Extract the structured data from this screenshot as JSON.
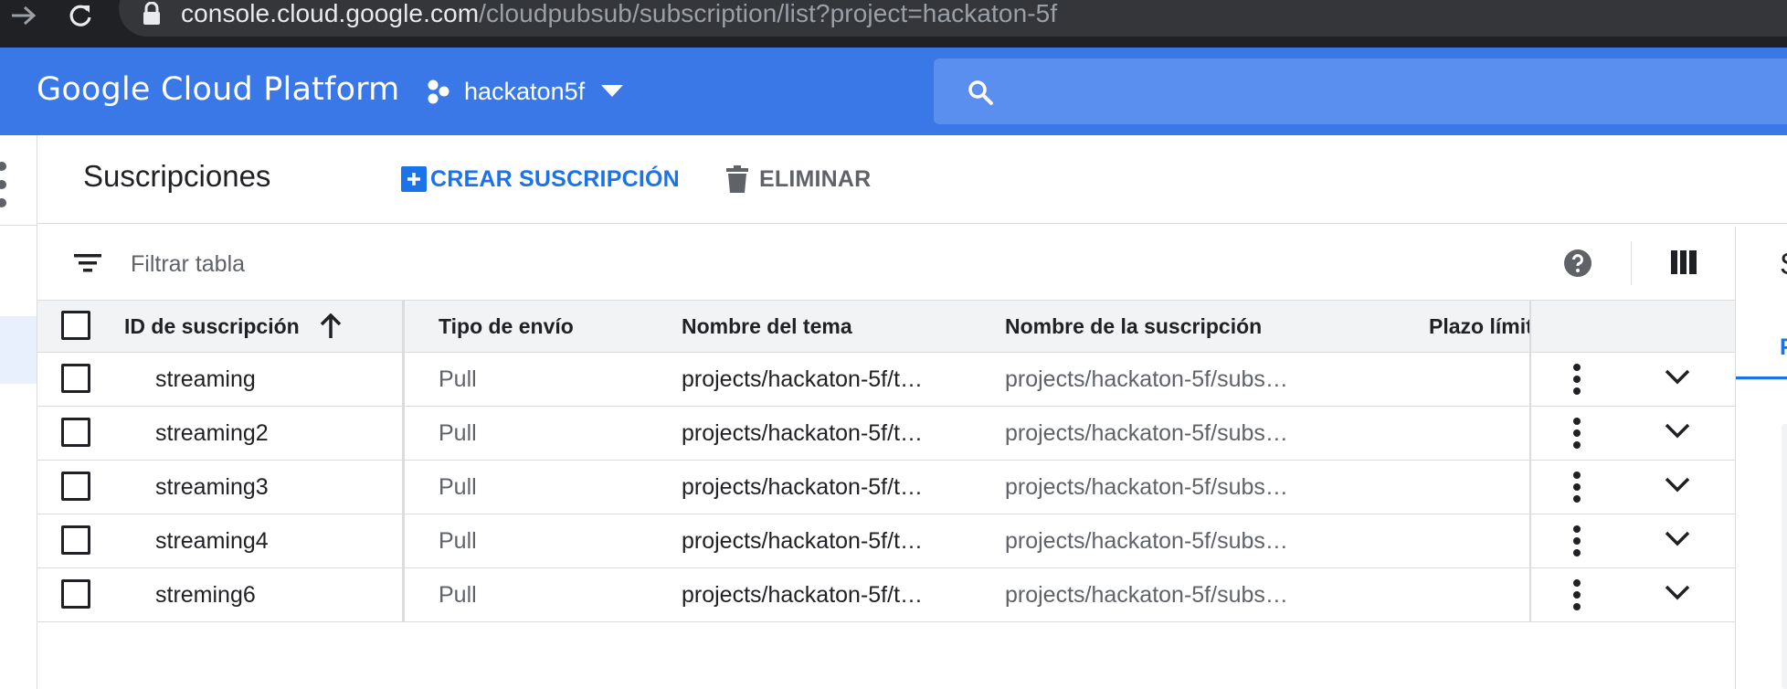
{
  "browser": {
    "url_host": "console.cloud.google.com",
    "url_path": "/cloudpubsub/subscription/list?project=hackaton-5f"
  },
  "header": {
    "brand": "Google Cloud Platform",
    "project": "hackaton5f",
    "search_placeholder": ""
  },
  "page": {
    "title": "Suscripciones",
    "create_label": "CREAR SUSCRIPCIÓN",
    "delete_label": "ELIMINAR"
  },
  "table": {
    "filter_placeholder": "Filtrar tabla",
    "columns": [
      "ID de suscripción",
      "Tipo de envío",
      "Nombre del tema",
      "Nombre de la suscripción",
      "Plazo límit"
    ],
    "sort": "ascending",
    "rows": [
      {
        "id": "streaming",
        "type": "Pull",
        "topic": "projects/hackaton-5f/t…",
        "name": "projects/hackaton-5f/subs…"
      },
      {
        "id": "streaming2",
        "type": "Pull",
        "topic": "projects/hackaton-5f/t…",
        "name": "projects/hackaton-5f/subs…"
      },
      {
        "id": "streaming3",
        "type": "Pull",
        "topic": "projects/hackaton-5f/t…",
        "name": "projects/hackaton-5f/subs…"
      },
      {
        "id": "streaming4",
        "type": "Pull",
        "topic": "projects/hackaton-5f/t…",
        "name": "projects/hackaton-5f/subs…"
      },
      {
        "id": "streming6",
        "type": "Pull",
        "topic": "projects/hackaton-5f/t…",
        "name": "projects/hackaton-5f/subs…"
      }
    ]
  },
  "side_panel": {
    "title_fragment": "S",
    "tab_fragment": "F"
  },
  "colors": {
    "header_bg": "#3b78e7",
    "accent": "#1a73e8",
    "browser_bg": "#202124"
  }
}
